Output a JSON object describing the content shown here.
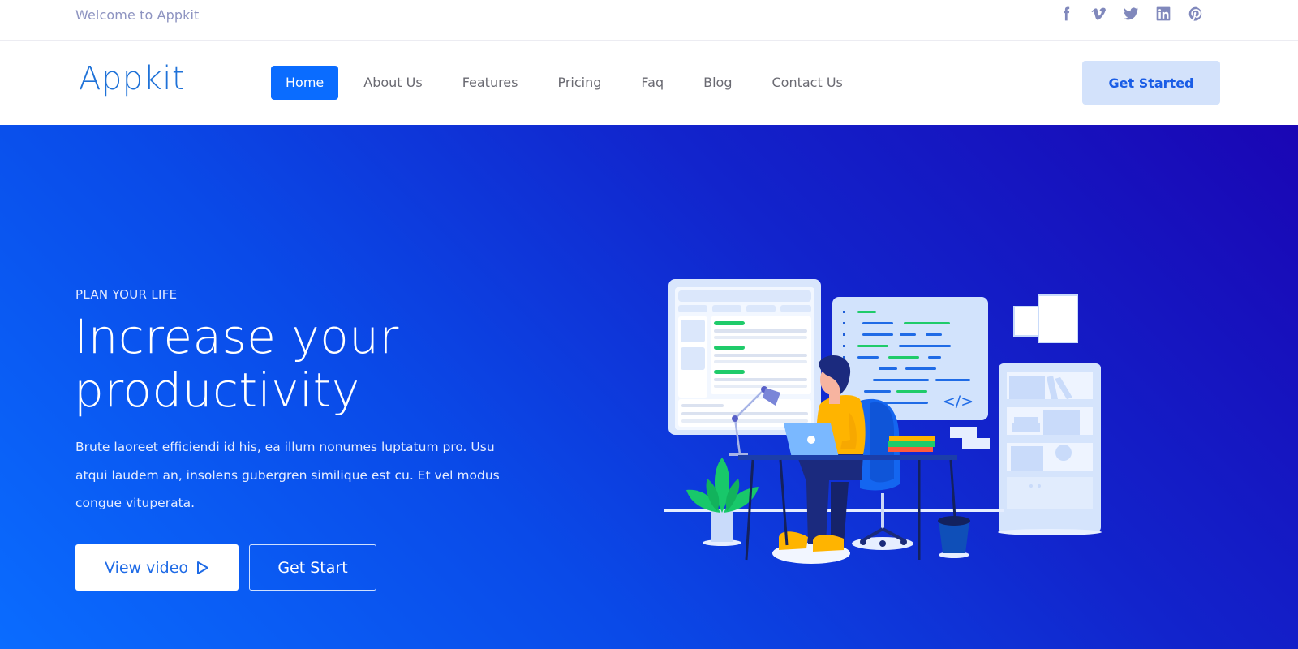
{
  "topbar": {
    "welcome": "Welcome to Appkit",
    "socials": [
      {
        "name": "facebook",
        "icon": "facebook-icon"
      },
      {
        "name": "vimeo",
        "icon": "vimeo-icon"
      },
      {
        "name": "twitter",
        "icon": "twitter-icon"
      },
      {
        "name": "linkedin",
        "icon": "linkedin-icon"
      },
      {
        "name": "pinterest",
        "icon": "pinterest-icon"
      }
    ]
  },
  "navbar": {
    "logo": "Appkit",
    "items": [
      {
        "label": "Home",
        "active": true
      },
      {
        "label": "About Us",
        "active": false
      },
      {
        "label": "Features",
        "active": false
      },
      {
        "label": "Pricing",
        "active": false
      },
      {
        "label": "Faq",
        "active": false
      },
      {
        "label": "Blog",
        "active": false
      },
      {
        "label": "Contact Us",
        "active": false
      }
    ],
    "cta": "Get Started"
  },
  "hero": {
    "eyebrow": "PLAN YOUR LIFE",
    "headline_line1": "Increase your",
    "headline_line2": "productivity",
    "description": "Brute laoreet efficiendi id his, ea illum nonumes luptatum pro. Usu atqui laudem an, insolens gubergren similique est cu. Et vel modus congue vituperata.",
    "primary_button": "View video",
    "primary_button_icon": "play-icon",
    "secondary_button": "Get Start",
    "illustration": "developer-at-desk-illustration",
    "code_tag": "</>"
  },
  "colors": {
    "accent": "#0a6cff",
    "gradient_start": "#0a6cff",
    "gradient_end": "#1a06b4",
    "cta_bg": "#d3e2fb",
    "logo": "#1f72d8"
  }
}
